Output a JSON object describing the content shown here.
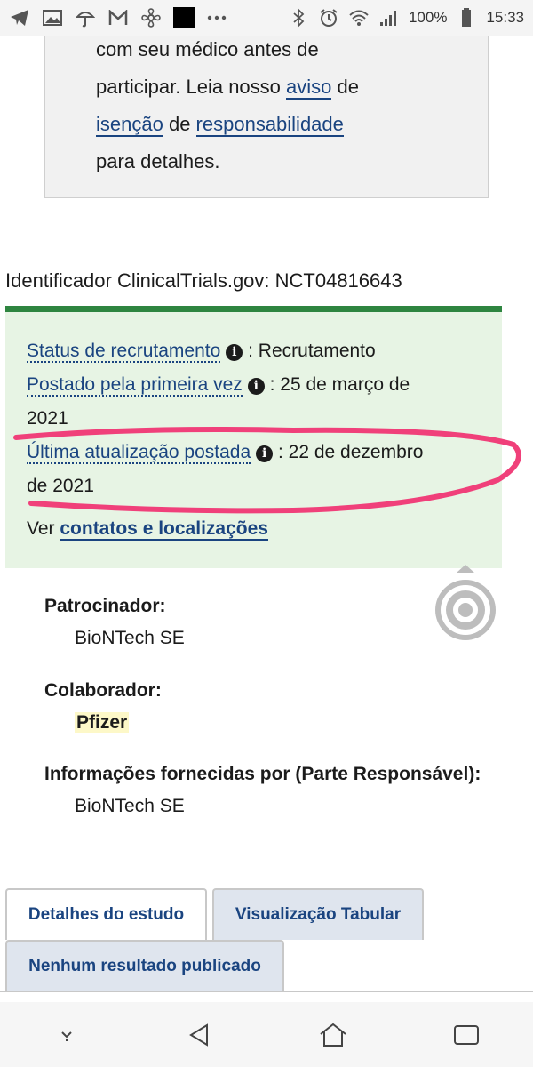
{
  "status_bar": {
    "battery": "100%",
    "time": "15:33",
    "icons": [
      "telegram-icon",
      "gallery-icon",
      "umbrella-icon",
      "gmail-icon",
      "pinwheel-icon",
      "app-black-icon",
      "more-dots-icon",
      "bluetooth-icon",
      "alarm-icon",
      "wifi-icon",
      "signal-icon",
      "battery-icon"
    ]
  },
  "disclaimer": {
    "line1": "com seu médico antes de",
    "line2_prefix": "participar. Leia nosso ",
    "line2_link": "aviso",
    "line2_suffix": " de",
    "line3_link1": "isenção",
    "line3_mid": " de ",
    "line3_link2": "responsabilidade",
    "line4": "para detalhes."
  },
  "identifier": {
    "label": "Identificador ClinicalTrials.gov: ",
    "value": "NCT04816643"
  },
  "status_panel": {
    "recruit_term": "Status de recrutamento",
    "recruit_value": " : Recrutamento",
    "first_posted_term": "Postado pela primeira vez",
    "first_posted_value": " : 25 de março de",
    "first_posted_value2": "2021",
    "last_update_term": "Última atualização postada",
    "last_update_value": " : 22 de dezembro",
    "last_update_value2": "de 2021",
    "see_prefix": "Ver ",
    "see_link": "contatos e localizações",
    "info_glyph": "i",
    "accent_color": "#2e8540",
    "highlight_color": "#f0407a"
  },
  "sponsor": {
    "label": "Patrocinador:",
    "value": "BioNTech SE"
  },
  "collaborator": {
    "label": "Colaborador:",
    "value": "Pfizer"
  },
  "responsible": {
    "label": "Informações fornecidas por (Parte Responsável):",
    "value": "BioNTech SE"
  },
  "tabs": [
    {
      "label": "Detalhes do estudo",
      "active": true
    },
    {
      "label": "Visualização Tabular",
      "active": false
    },
    {
      "label": "Nenhum resultado publicado",
      "active": false
    }
  ],
  "nav": [
    "keyboard-hide-icon",
    "back-icon",
    "home-icon",
    "recents-icon"
  ]
}
